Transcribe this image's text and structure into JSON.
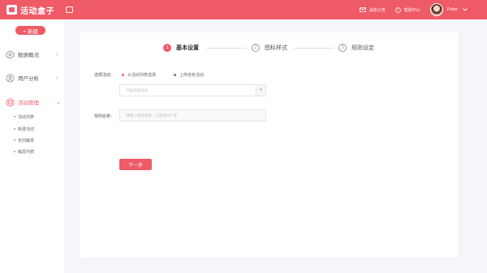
{
  "header": {
    "logo_text": "活动盒子",
    "messages_label": "消息公告",
    "help_label": "帮助中心",
    "user_name": "Peter",
    "brand_color": "#ef5a67"
  },
  "sidebar": {
    "new_button": "+ 新建",
    "sections": [
      {
        "label": "数据概况",
        "icon": "chart-icon",
        "chevron": "‹"
      },
      {
        "label": "用户分析",
        "icon": "user-icon",
        "chevron": "‹"
      },
      {
        "label": "活动管理",
        "icon": "activity-icon",
        "chevron": "⌄"
      }
    ],
    "sub_items": [
      {
        "label": "活动列表"
      },
      {
        "label": "新建活动"
      },
      {
        "label": "定向触发"
      },
      {
        "label": "触发列表"
      }
    ]
  },
  "steps": [
    {
      "num": "1",
      "label": "基本设置",
      "active": true
    },
    {
      "num": "2",
      "label": "图标样式",
      "active": false
    },
    {
      "num": "3",
      "label": "规则设定",
      "active": false
    }
  ],
  "form": {
    "select_activity_label": "选择活动：",
    "radio_options": [
      {
        "label": "从活动列表选择",
        "selected": true
      },
      {
        "label": "上传自有活动",
        "selected": false
      }
    ],
    "activity_placeholder": "点击添加活动",
    "add_symbol": "+",
    "rule_name_label": "规则名称：",
    "rule_name_placeholder": "请输入规则名称，只支持10个字",
    "next_button": "下一步"
  }
}
